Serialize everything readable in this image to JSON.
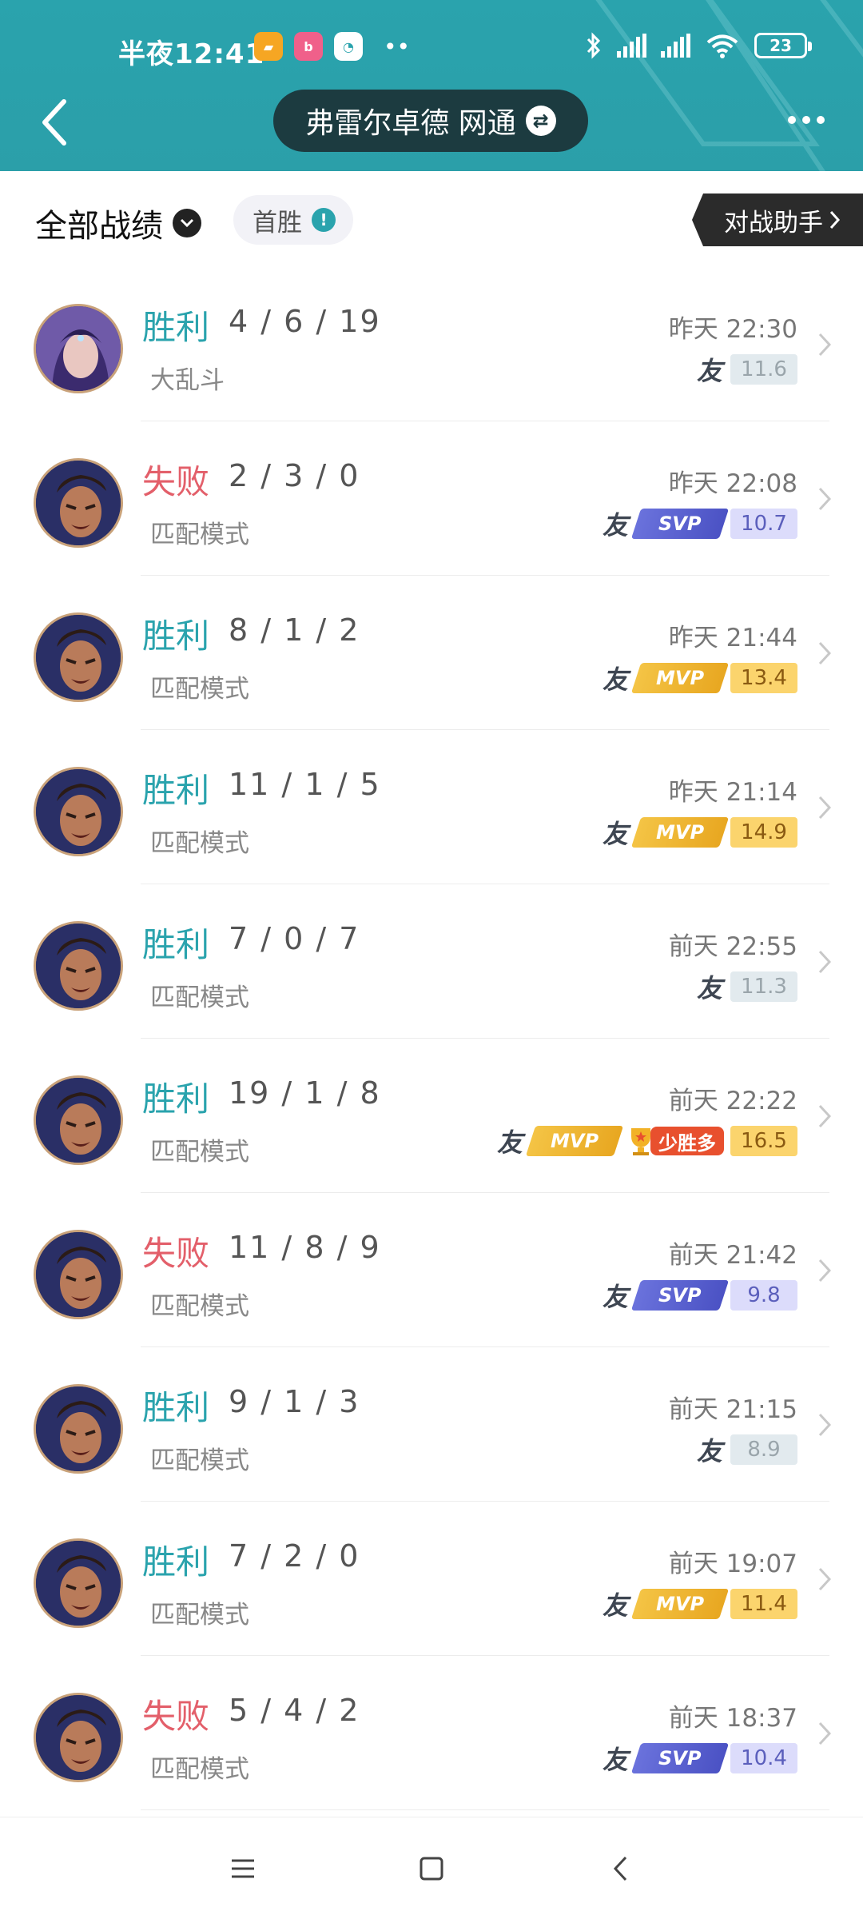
{
  "status_bar": {
    "time": "半夜12:41",
    "app_icons": [
      "notes-app",
      "bilibili-app",
      "messenger-app"
    ],
    "overflow": "••",
    "battery": "23"
  },
  "header": {
    "title": "弗雷尔卓德 网通",
    "swap_glyph": "⇄",
    "colors": {
      "bg": "#2aa3ad",
      "pill": "#1c3b40"
    }
  },
  "filter": {
    "all_label": "全部战绩",
    "first_win_label": "首胜",
    "info_glyph": "!",
    "assistant_label": "对战助手"
  },
  "matches": [
    {
      "result": "胜利",
      "kda": "4 / 6 / 19",
      "mode": "大乱斗",
      "time": "昨天 22:30",
      "friend": "友",
      "tag": "",
      "streak": "",
      "score": "11.6",
      "avatar": "hero-female"
    },
    {
      "result": "失败",
      "kda": "2 / 3 / 0",
      "mode": "匹配模式",
      "time": "昨天 22:08",
      "friend": "友",
      "tag": "SVP",
      "streak": "",
      "score": "10.7",
      "avatar": "hero-male"
    },
    {
      "result": "胜利",
      "kda": "8 / 1 / 2",
      "mode": "匹配模式",
      "time": "昨天 21:44",
      "friend": "友",
      "tag": "MVP",
      "streak": "",
      "score": "13.4",
      "avatar": "hero-male"
    },
    {
      "result": "胜利",
      "kda": "11 / 1 / 5",
      "mode": "匹配模式",
      "time": "昨天 21:14",
      "friend": "友",
      "tag": "MVP",
      "streak": "",
      "score": "14.9",
      "avatar": "hero-male"
    },
    {
      "result": "胜利",
      "kda": "7 / 0 / 7",
      "mode": "匹配模式",
      "time": "前天 22:55",
      "friend": "友",
      "tag": "",
      "streak": "",
      "score": "11.3",
      "avatar": "hero-male"
    },
    {
      "result": "胜利",
      "kda": "19 / 1 / 8",
      "mode": "匹配模式",
      "time": "前天 22:22",
      "friend": "友",
      "tag": "MVP",
      "streak": "少胜多",
      "score": "16.5",
      "avatar": "hero-male"
    },
    {
      "result": "失败",
      "kda": "11 / 8 / 9",
      "mode": "匹配模式",
      "time": "前天 21:42",
      "friend": "友",
      "tag": "SVP",
      "streak": "",
      "score": "9.8",
      "avatar": "hero-male"
    },
    {
      "result": "胜利",
      "kda": "9 / 1 / 3",
      "mode": "匹配模式",
      "time": "前天 21:15",
      "friend": "友",
      "tag": "",
      "streak": "",
      "score": "8.9",
      "avatar": "hero-male"
    },
    {
      "result": "胜利",
      "kda": "7 / 2 / 0",
      "mode": "匹配模式",
      "time": "前天 19:07",
      "friend": "友",
      "tag": "MVP",
      "streak": "",
      "score": "11.4",
      "avatar": "hero-male"
    },
    {
      "result": "失败",
      "kda": "5 / 4 / 2",
      "mode": "匹配模式",
      "time": "前天 18:37",
      "friend": "友",
      "tag": "SVP",
      "streak": "",
      "score": "10.4",
      "avatar": "hero-male"
    }
  ],
  "result_colors": {
    "胜利": "#2aa3ad",
    "失败": "#e35f6a"
  },
  "nav": [
    "menu-icon",
    "home-icon",
    "back-icon"
  ]
}
